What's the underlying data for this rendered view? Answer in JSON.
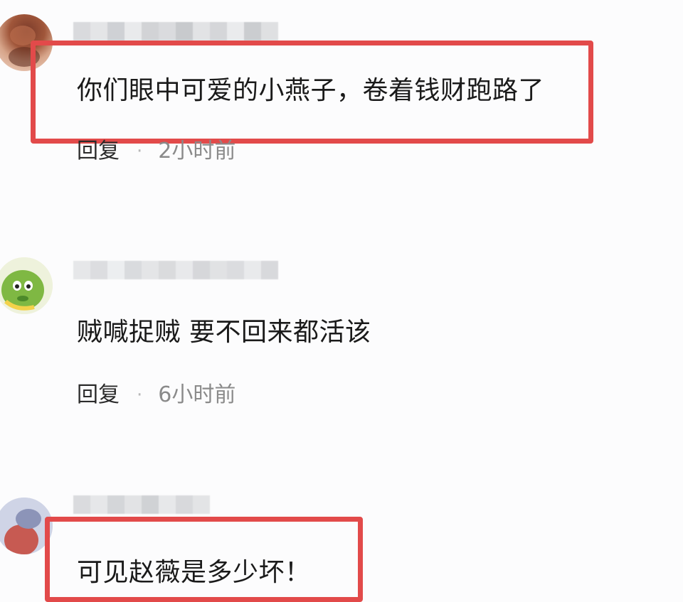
{
  "comments": [
    {
      "text": "你们眼中可爱的小燕子，卷着钱财跑路了",
      "reply_label": "回复",
      "separator": "·",
      "time": "2小时前",
      "highlighted": true
    },
    {
      "text": "贼喊捉贼 要不回来都活该",
      "reply_label": "回复",
      "separator": "·",
      "time": "6小时前",
      "highlighted": false
    },
    {
      "text": "可见赵薇是多少坏！",
      "highlighted": true
    }
  ],
  "colors": {
    "highlight_border": "#e24a4a",
    "background": "#fcfcfd",
    "time_text": "#8a8a8a"
  },
  "icons": {
    "comment_1_avatar": "avatar",
    "comment_2_avatar": "avatar",
    "comment_3_avatar": "avatar"
  }
}
